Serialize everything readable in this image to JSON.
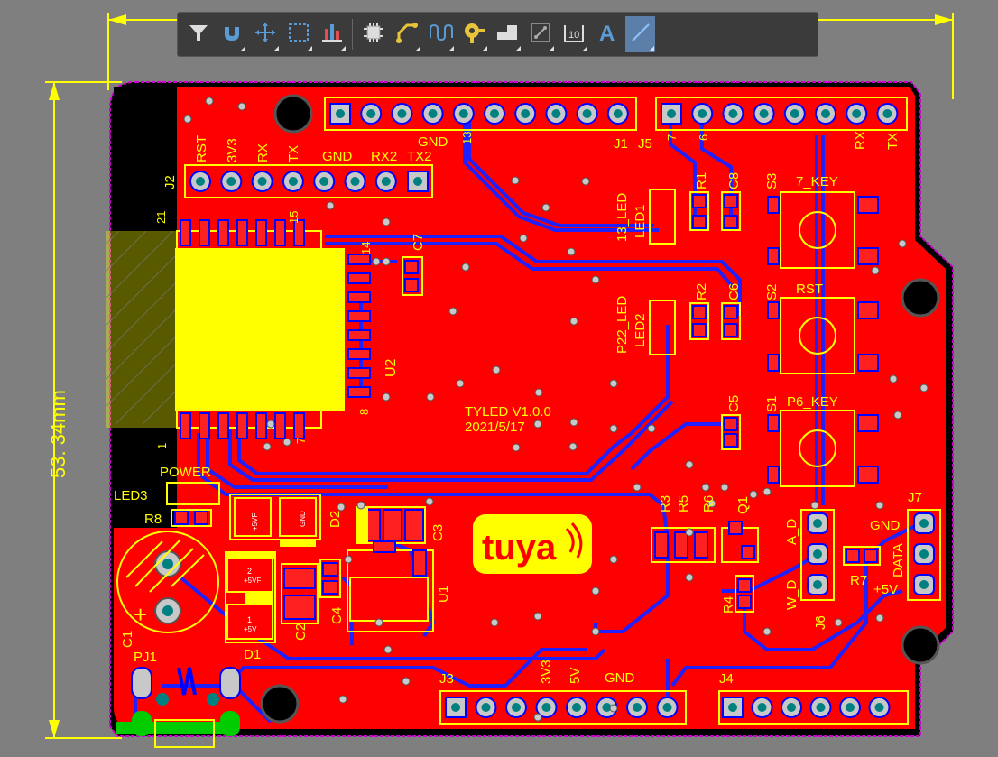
{
  "toolbar": {
    "buttons": [
      {
        "name": "filter-icon"
      },
      {
        "name": "magnet-icon"
      },
      {
        "name": "move-cross-icon"
      },
      {
        "name": "select-rectangle-icon"
      },
      {
        "name": "align-bars-icon"
      },
      {
        "name": "component-chip-icon"
      },
      {
        "name": "route-track-icon"
      },
      {
        "name": "interactive-diff-pair-icon"
      },
      {
        "name": "via-pad-icon"
      },
      {
        "name": "polygon-pour-icon"
      },
      {
        "name": "keepout-region-icon"
      },
      {
        "name": "dimension-icon"
      },
      {
        "name": "text-string-icon",
        "glyph": "A"
      },
      {
        "name": "line-draw-icon"
      }
    ]
  },
  "dimensions": {
    "vertical_label": "53. 34mm"
  },
  "board": {
    "colors": {
      "copper": "#ff0000",
      "silk": "#ffff00",
      "trace": "#1a1aff",
      "pad": "#c8c8c8",
      "hole": "#008080",
      "outline": "#cc00cc",
      "background": "#7f7f7f",
      "mechanical": "#000000",
      "green": "#00cc00"
    },
    "labels": {
      "j2_pins": [
        "RST",
        "3V3",
        "RX",
        "TX",
        "GND",
        "RX2",
        "TX2"
      ],
      "j2": "J2",
      "j1": "J1",
      "j1_gnd": "GND",
      "j1_13": "13",
      "j5": "J5",
      "j5_7": "7",
      "j5_6": "6",
      "j5_rx": "RX",
      "j5_tx": "TX",
      "u2": "U2",
      "u2_pin21": "21",
      "u2_pin15": "15",
      "u2_pin14": "14",
      "u2_pin8": "8",
      "u2_pin7": "7",
      "u2_pin1": "1",
      "c7": "C7",
      "led1_a": "13_LED",
      "led1_b": "LED1",
      "r1": "R1",
      "c8": "C8",
      "s3": "S3",
      "key7": "7_KEY",
      "led2_a": "P22_LED",
      "led2_b": "LED2",
      "r2": "R2",
      "c6": "C6",
      "s2": "S2",
      "rst": "RST",
      "c5": "C5",
      "s1": "S1",
      "p6key": "P6_KEY",
      "title1": "TYLED V1.0.0",
      "title2": "2021/5/17",
      "power": "POWER",
      "led3": "LED3",
      "r8": "R8",
      "d2": "D2",
      "c3": "C3",
      "u1": "U1",
      "c4": "C4",
      "c2": "C2",
      "d1": "D1",
      "c1": "C1",
      "pj1": "PJ1",
      "r3": "R3",
      "r5": "R5",
      "r6": "R6",
      "q1": "Q1",
      "r4": "R4",
      "a_d": "A_D",
      "w_d": "W_D",
      "j6": "J6",
      "r7": "R7",
      "j7": "J7",
      "j7_gnd": "GND",
      "j7_data": "DATA",
      "j7_5v": "+5V",
      "j3": "J3",
      "j3_3v3": "3V3",
      "j3_5v": "5V",
      "j3_gnd": "GND",
      "j4": "J4",
      "tuya": "tuya",
      "plus": "+",
      "d2_pin": "+5VF",
      "d2_gnd": "GND",
      "d1_pin_top": "+5VF",
      "d1_pin_bot": "+5V",
      "d1_n2": "2",
      "d1_n1": "1"
    }
  }
}
